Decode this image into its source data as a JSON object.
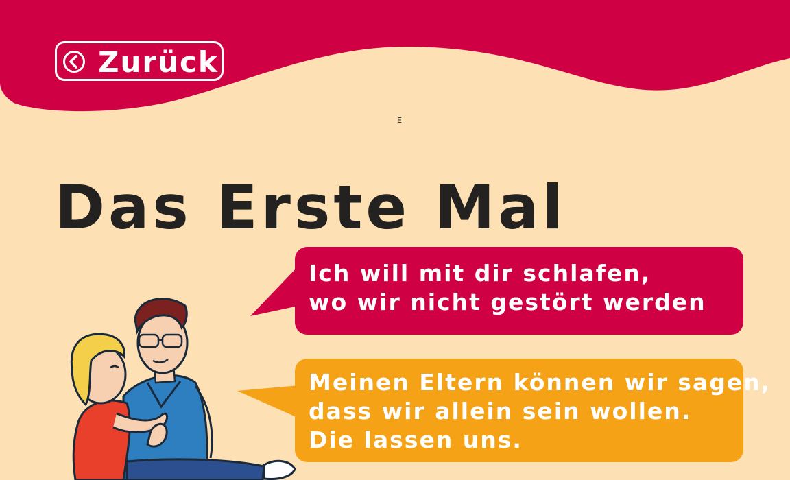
{
  "colors": {
    "header": "#d00045",
    "background": "#fde0b4",
    "bubble_1": "#d00045",
    "bubble_2": "#f5a216",
    "title": "#232220"
  },
  "nav": {
    "back_label": "Zurück",
    "back_icon": "circle-chevron-left-icon"
  },
  "marker": "E",
  "page": {
    "title": "Das Erste Mal"
  },
  "dialog": {
    "bubble_1": [
      "Ich will mit dir schlafen,",
      "wo wir nicht gestört werden"
    ],
    "bubble_2": [
      "Meinen Eltern können wir sagen,",
      "dass wir allein sein wollen.",
      "Die lassen uns."
    ]
  }
}
